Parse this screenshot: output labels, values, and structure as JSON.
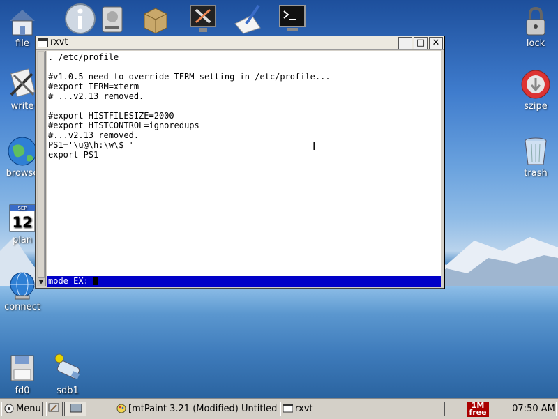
{
  "desktop": {
    "icons": [
      {
        "label": "file",
        "icon": "home-folder-icon"
      },
      {
        "label": "write",
        "icon": "writing-tools-icon"
      },
      {
        "label": "browse",
        "icon": "globe-icon"
      },
      {
        "label": "plan",
        "icon": "calendar-icon",
        "calendar_month": "SEP",
        "calendar_day": "12"
      },
      {
        "label": "connect",
        "icon": "network-globe-icon"
      },
      {
        "label": "fd0",
        "icon": "floppy-drive-icon"
      },
      {
        "label": "sdb1",
        "icon": "usb-drive-icon"
      },
      {
        "label": "lock",
        "icon": "padlock-icon"
      },
      {
        "label": "szipe",
        "icon": "archive-icon"
      },
      {
        "label": "trash",
        "icon": "trash-can-icon"
      }
    ],
    "top_icons": [
      "info-icon",
      "hard-drive-icon",
      "package-icon",
      "settings-screen-icon",
      "text-editor-icon",
      "terminal-icon"
    ]
  },
  "window": {
    "title": "rxvt",
    "minimize": "_",
    "maximize": "□",
    "close": "✕",
    "lines": [
      ". /etc/profile",
      "",
      "#v1.0.5 need to override TERM setting in /etc/profile...",
      "#export TERM=xterm",
      "# ...v2.13 removed.",
      "",
      "#export HISTFILESIZE=2000",
      "#export HISTCONTROL=ignoredups",
      "#...v2.13 removed.",
      "PS1='\\u@\\h:\\w\\$ '",
      "export PS1"
    ],
    "status_line": "mode EX: "
  },
  "taskbar": {
    "menu_label": "Menu",
    "tasks": [
      {
        "label": "[mtPaint 3.21 (Modified) Untitled]",
        "icon": "mtpaint-icon"
      },
      {
        "label": "rxvt",
        "icon": "terminal-icon"
      }
    ],
    "memory_value": "1M",
    "memory_unit": "free",
    "clock": "07:50 AM"
  }
}
